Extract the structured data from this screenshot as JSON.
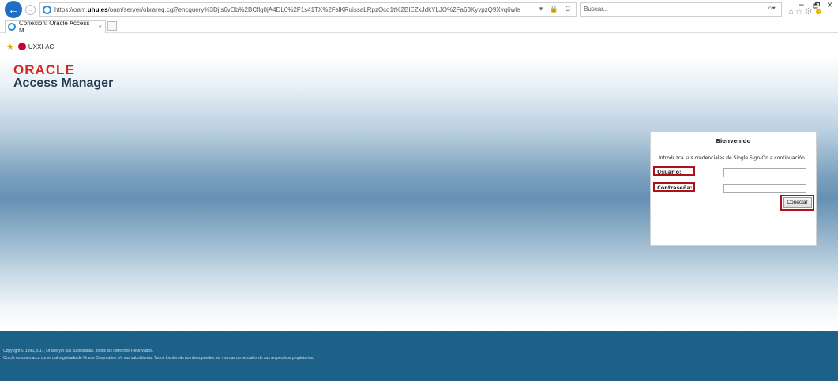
{
  "browser": {
    "url_prefix": "https://oam.",
    "url_domain": "uhu.es",
    "url_rest": "/oam/server/obrareq.cgi?encquery%3Djis6vOb%2BCflg0jA4DL6%2F1s41TX%2FslKRuissaLRpzQcq1t%2BIEZxJdkYLJO%2Fa63KyvpzQ9Xvq6wleU8L4tMTSjvu7ZvUxY7bewlbx",
    "address_tools": "▾ 🔒 C",
    "search_placeholder": "Buscar...",
    "search_button": "⌕▾",
    "tab_title": "Conexión: Oracle Access M...",
    "tab_close": "×",
    "favorite_link": "UXXI-AC",
    "window_min": "–",
    "window_max": "🗗",
    "window_close": "×"
  },
  "page": {
    "logo_text": "ORACLE",
    "product_name": "Access Manager"
  },
  "login": {
    "title": "Bienvenido",
    "instructions": "Introduzca sus credenciales de Single Sign-On a continuación",
    "username_label": "Usuario:",
    "password_label": "Contraseña:",
    "username_value": "",
    "password_value": "",
    "submit_label": "Conectar",
    "highlight_color": "#b0101a"
  },
  "footer": {
    "copyright": "Copyright © 1996,2017, Oracle y/o sus subsidiarias. Todos los Derechos Reservados.",
    "trademark": "Oracle es una marca comercial registrada de Oracle Corporation y/o sus subsidiarias. Todos los demás nombres pueden ser marcas comerciales de sus respectivos propietarios."
  },
  "colors": {
    "oracle_red": "#d8261d",
    "footer_bg": "#1d6088",
    "browser_accent": "#1e6fc2"
  }
}
